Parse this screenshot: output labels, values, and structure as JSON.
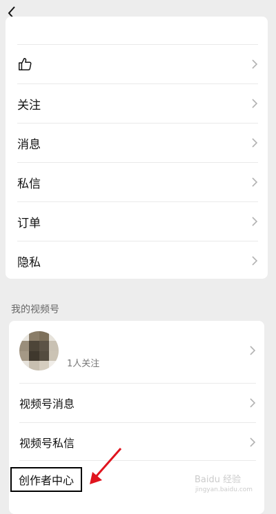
{
  "nav": {
    "back_icon": "chevron-left-icon"
  },
  "settings_list": {
    "rows": [
      {
        "icon": "thumbs-up-icon",
        "label": ""
      },
      {
        "label": "关注"
      },
      {
        "label": "消息"
      },
      {
        "label": "私信"
      },
      {
        "label": "订单"
      },
      {
        "label": "隐私"
      }
    ]
  },
  "channels": {
    "section_title": "我的视频号",
    "followers_text": "1人关注",
    "rows": [
      {
        "label": "视频号消息"
      },
      {
        "label": "视频号私信"
      },
      {
        "label": "创作者中心"
      }
    ]
  },
  "annotation": {
    "arrow_color": "#e0141e"
  },
  "watermark": {
    "text": "Baidu 经验",
    "sub": "jingyan.baidu.com"
  },
  "colors": {
    "background": "#ededed",
    "card": "#ffffff",
    "chevron": "#b2b2b2"
  }
}
